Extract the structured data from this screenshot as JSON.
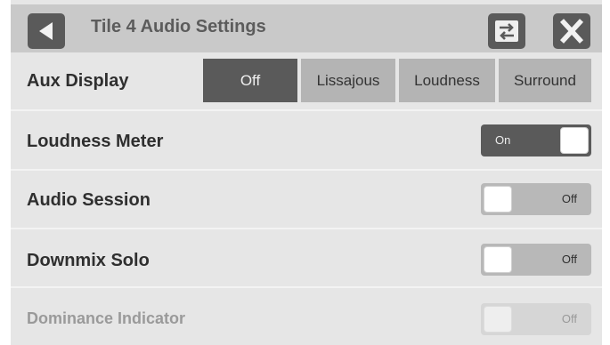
{
  "header": {
    "title": "Tile 4 Audio Settings",
    "back_icon": "back-arrow-icon",
    "swap_icon": "swap-arrows-icon",
    "close_icon": "close-x-icon"
  },
  "aux_display": {
    "label": "Aux Display",
    "options": [
      "Off",
      "Lissajous",
      "Loudness",
      "Surround"
    ],
    "selected": "Off"
  },
  "loudness_meter": {
    "label": "Loudness Meter",
    "state": "On"
  },
  "audio_session": {
    "label": "Audio Session",
    "state": "Off"
  },
  "downmix_solo": {
    "label": "Downmix Solo",
    "state": "Off"
  },
  "dominance_indicator": {
    "label": "Dominance Indicator",
    "state": "Off",
    "enabled": false
  },
  "colors": {
    "panel": "#e6e6e6",
    "header": "#c9c9c9",
    "accent_dark": "#5a5a5a",
    "segment": "#b4b4b4"
  }
}
